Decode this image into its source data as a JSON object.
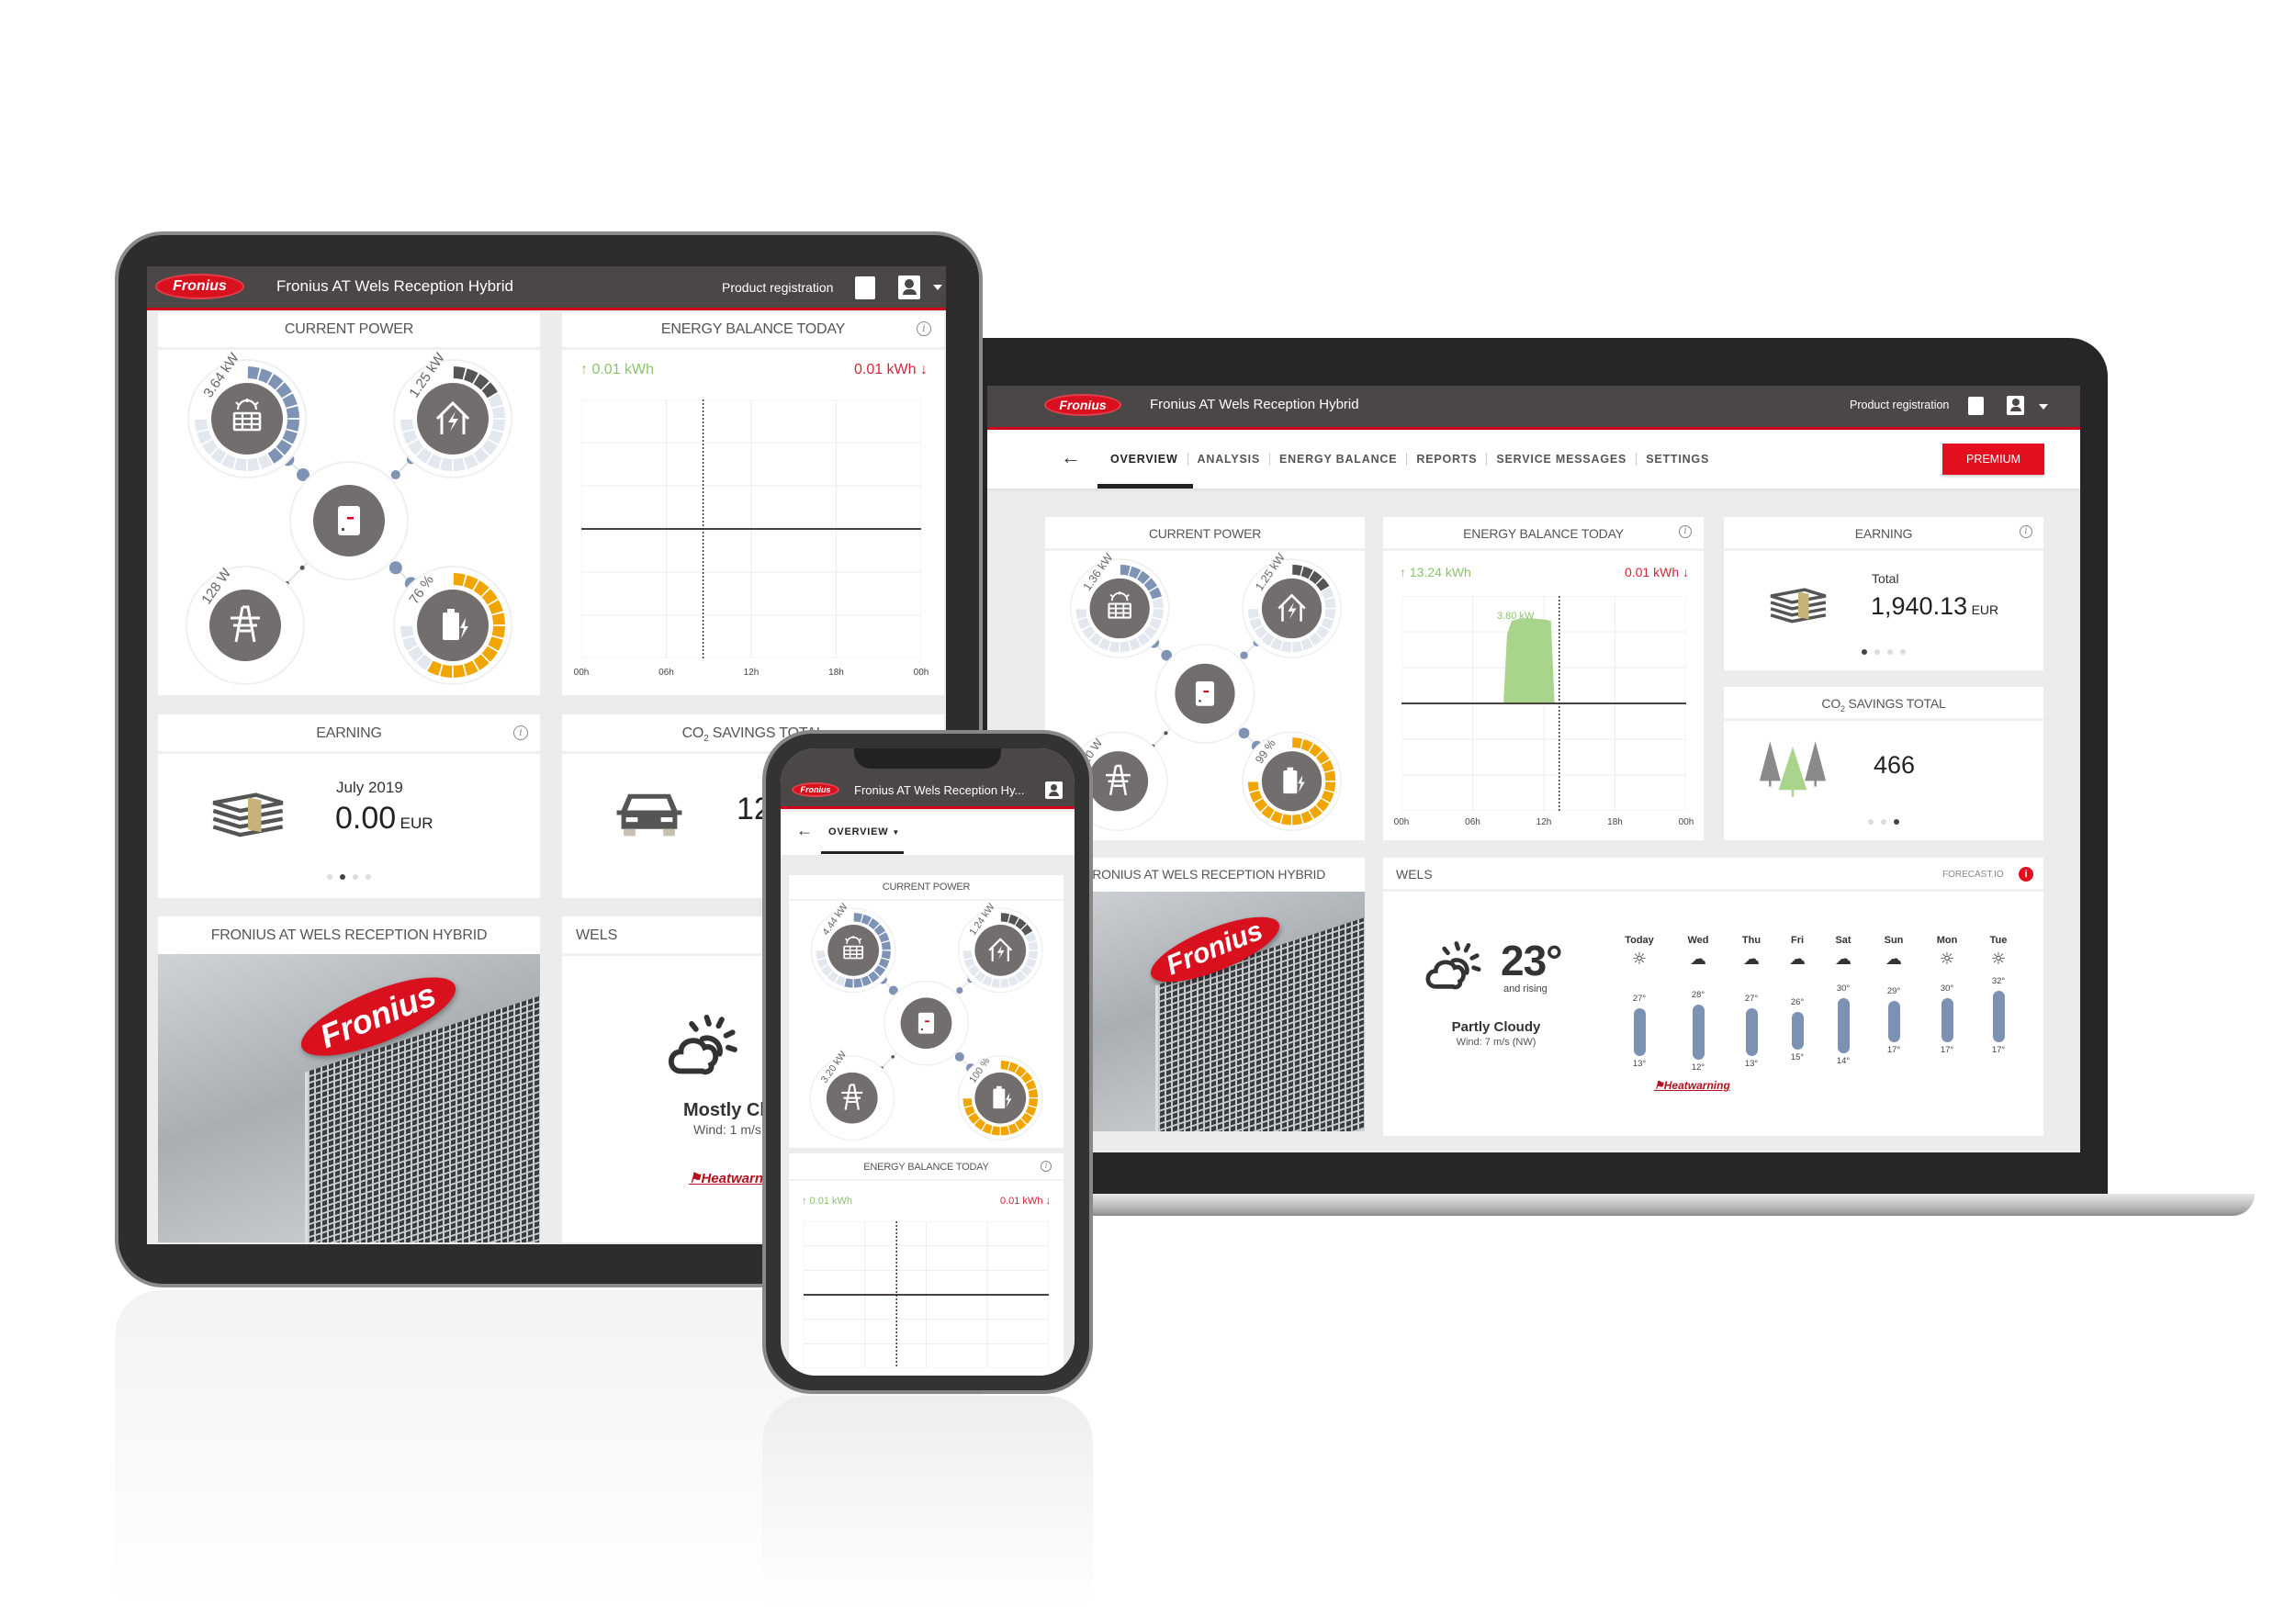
{
  "colors": {
    "brand_red": "#d0021b",
    "header_bg": "#4b4747",
    "pv_blue": "#7f93b5",
    "battery_orange": "#f0a500",
    "production_green": "#a9d48c",
    "consumption_red": "#d0263a"
  },
  "tablet": {
    "header": {
      "logo": "Fronius",
      "title": "Fronius AT Wels Reception Hybrid",
      "product_registration": "Product registration",
      "icons": [
        "certificate-icon",
        "user-icon",
        "caret-down-icon"
      ]
    },
    "current_power": {
      "title": "CURRENT POWER",
      "pv": "3.64 kW",
      "load": "1.25 kW",
      "grid": "128 W",
      "battery": "76 %",
      "pv_level": 0.55,
      "load_level": 0.22,
      "battery_level": 0.76
    },
    "energy_balance": {
      "title": "ENERGY BALANCE TODAY",
      "produced": "↑ 0.01 kWh",
      "consumed": "0.01 kWh ↓",
      "x_ticks": [
        "00h",
        "06h",
        "12h",
        "18h",
        "00h"
      ],
      "now_hour": 8.6,
      "production_kw": []
    },
    "earning": {
      "title": "EARNING",
      "period": "July 2019",
      "value": "0.00",
      "currency": "EUR",
      "page": 2,
      "pages": 4
    },
    "co2": {
      "title_prefix": "CO",
      "title_sub": "2",
      "title_suffix": " SAVINGS TOTAL",
      "value": "12"
    },
    "photo": {
      "title": "FRONIUS AT WELS RECEPTION HYBRID",
      "sign": "Fronius"
    },
    "weather": {
      "title": "WELS",
      "condition": "Mostly Cloudy",
      "wind": "Wind: 1 m/s",
      "warning": "Heatwarning"
    }
  },
  "laptop": {
    "header": {
      "logo": "Fronius",
      "title": "Fronius AT Wels Reception Hybrid",
      "product_registration": "Product registration"
    },
    "nav": {
      "tabs": [
        "OVERVIEW",
        "ANALYSIS",
        "ENERGY BALANCE",
        "REPORTS",
        "SERVICE MESSAGES",
        "SETTINGS"
      ],
      "active": 0,
      "premium": "PREMIUM"
    },
    "current_power": {
      "title": "CURRENT POWER",
      "pv": "1.36 kW",
      "load": "1.25 kW",
      "grid": "10 W",
      "battery": "99 %",
      "pv_level": 0.3,
      "load_level": 0.22,
      "battery_level": 0.99
    },
    "energy_balance": {
      "title": "ENERGY BALANCE TODAY",
      "produced": "↑ 13.24 kWh",
      "consumed": "0.01 kWh ↓",
      "peak_label": "3.80 kW",
      "x_ticks": [
        "00h",
        "06h",
        "12h",
        "18h",
        "00h"
      ],
      "now_hour": 13.3,
      "y_max_kw": 4.8,
      "production_kw": [
        [
          8.6,
          0
        ],
        [
          8.9,
          3.1
        ],
        [
          9.3,
          3.7
        ],
        [
          10,
          3.8
        ],
        [
          11,
          3.8
        ],
        [
          12,
          3.75
        ],
        [
          12.6,
          3.7
        ],
        [
          12.9,
          0
        ]
      ]
    },
    "earning": {
      "title": "EARNING",
      "label": "Total",
      "value": "1,940.13",
      "currency": "EUR",
      "page": 1,
      "pages": 4
    },
    "co2": {
      "title_prefix": "CO",
      "title_sub": "2",
      "title_suffix": " SAVINGS TOTAL",
      "value": "466",
      "page": 3,
      "pages": 3
    },
    "photo": {
      "title": "FRONIUS AT WELS RECEPTION HYBRID",
      "sign": "Fronius"
    },
    "weather": {
      "title": "WELS",
      "source": "FORECAST.IO",
      "temperature": "23°",
      "trend": "and rising",
      "condition": "Partly Cloudy",
      "wind": "Wind: 7 m/s (NW)",
      "warning": "Heatwarning",
      "forecast": [
        {
          "day": "Today",
          "icon": "sunny",
          "high": 27,
          "low": 13
        },
        {
          "day": "Wed",
          "icon": "partly-cloudy",
          "high": 28,
          "low": 12
        },
        {
          "day": "Thu",
          "icon": "partly-cloudy",
          "high": 27,
          "low": 13
        },
        {
          "day": "Fri",
          "icon": "cloudy",
          "high": 26,
          "low": 15
        },
        {
          "day": "Sat",
          "icon": "partly-cloudy",
          "high": 30,
          "low": 14
        },
        {
          "day": "Sun",
          "icon": "cloudy",
          "high": 29,
          "low": 17
        },
        {
          "day": "Mon",
          "icon": "sunny",
          "high": 30,
          "low": 17
        },
        {
          "day": "Tue",
          "icon": "sunny",
          "high": 32,
          "low": 17
        }
      ]
    }
  },
  "phone": {
    "header": {
      "logo": "Fronius",
      "title": "Fronius AT Wels Reception Hy..."
    },
    "nav": {
      "active_tab": "OVERVIEW"
    },
    "current_power": {
      "title": "CURRENT POWER",
      "pv": "4.44 kW",
      "load": "1.24 kW",
      "grid": "3.20 kW",
      "battery": "100 %",
      "pv_level": 0.7,
      "load_level": 0.22,
      "battery_level": 1.0
    },
    "energy_balance": {
      "title": "ENERGY BALANCE TODAY",
      "produced": "↑ 0.01 kWh",
      "consumed": "0.01 kWh ↓",
      "now_hour": 9.1,
      "production_kw": []
    }
  }
}
